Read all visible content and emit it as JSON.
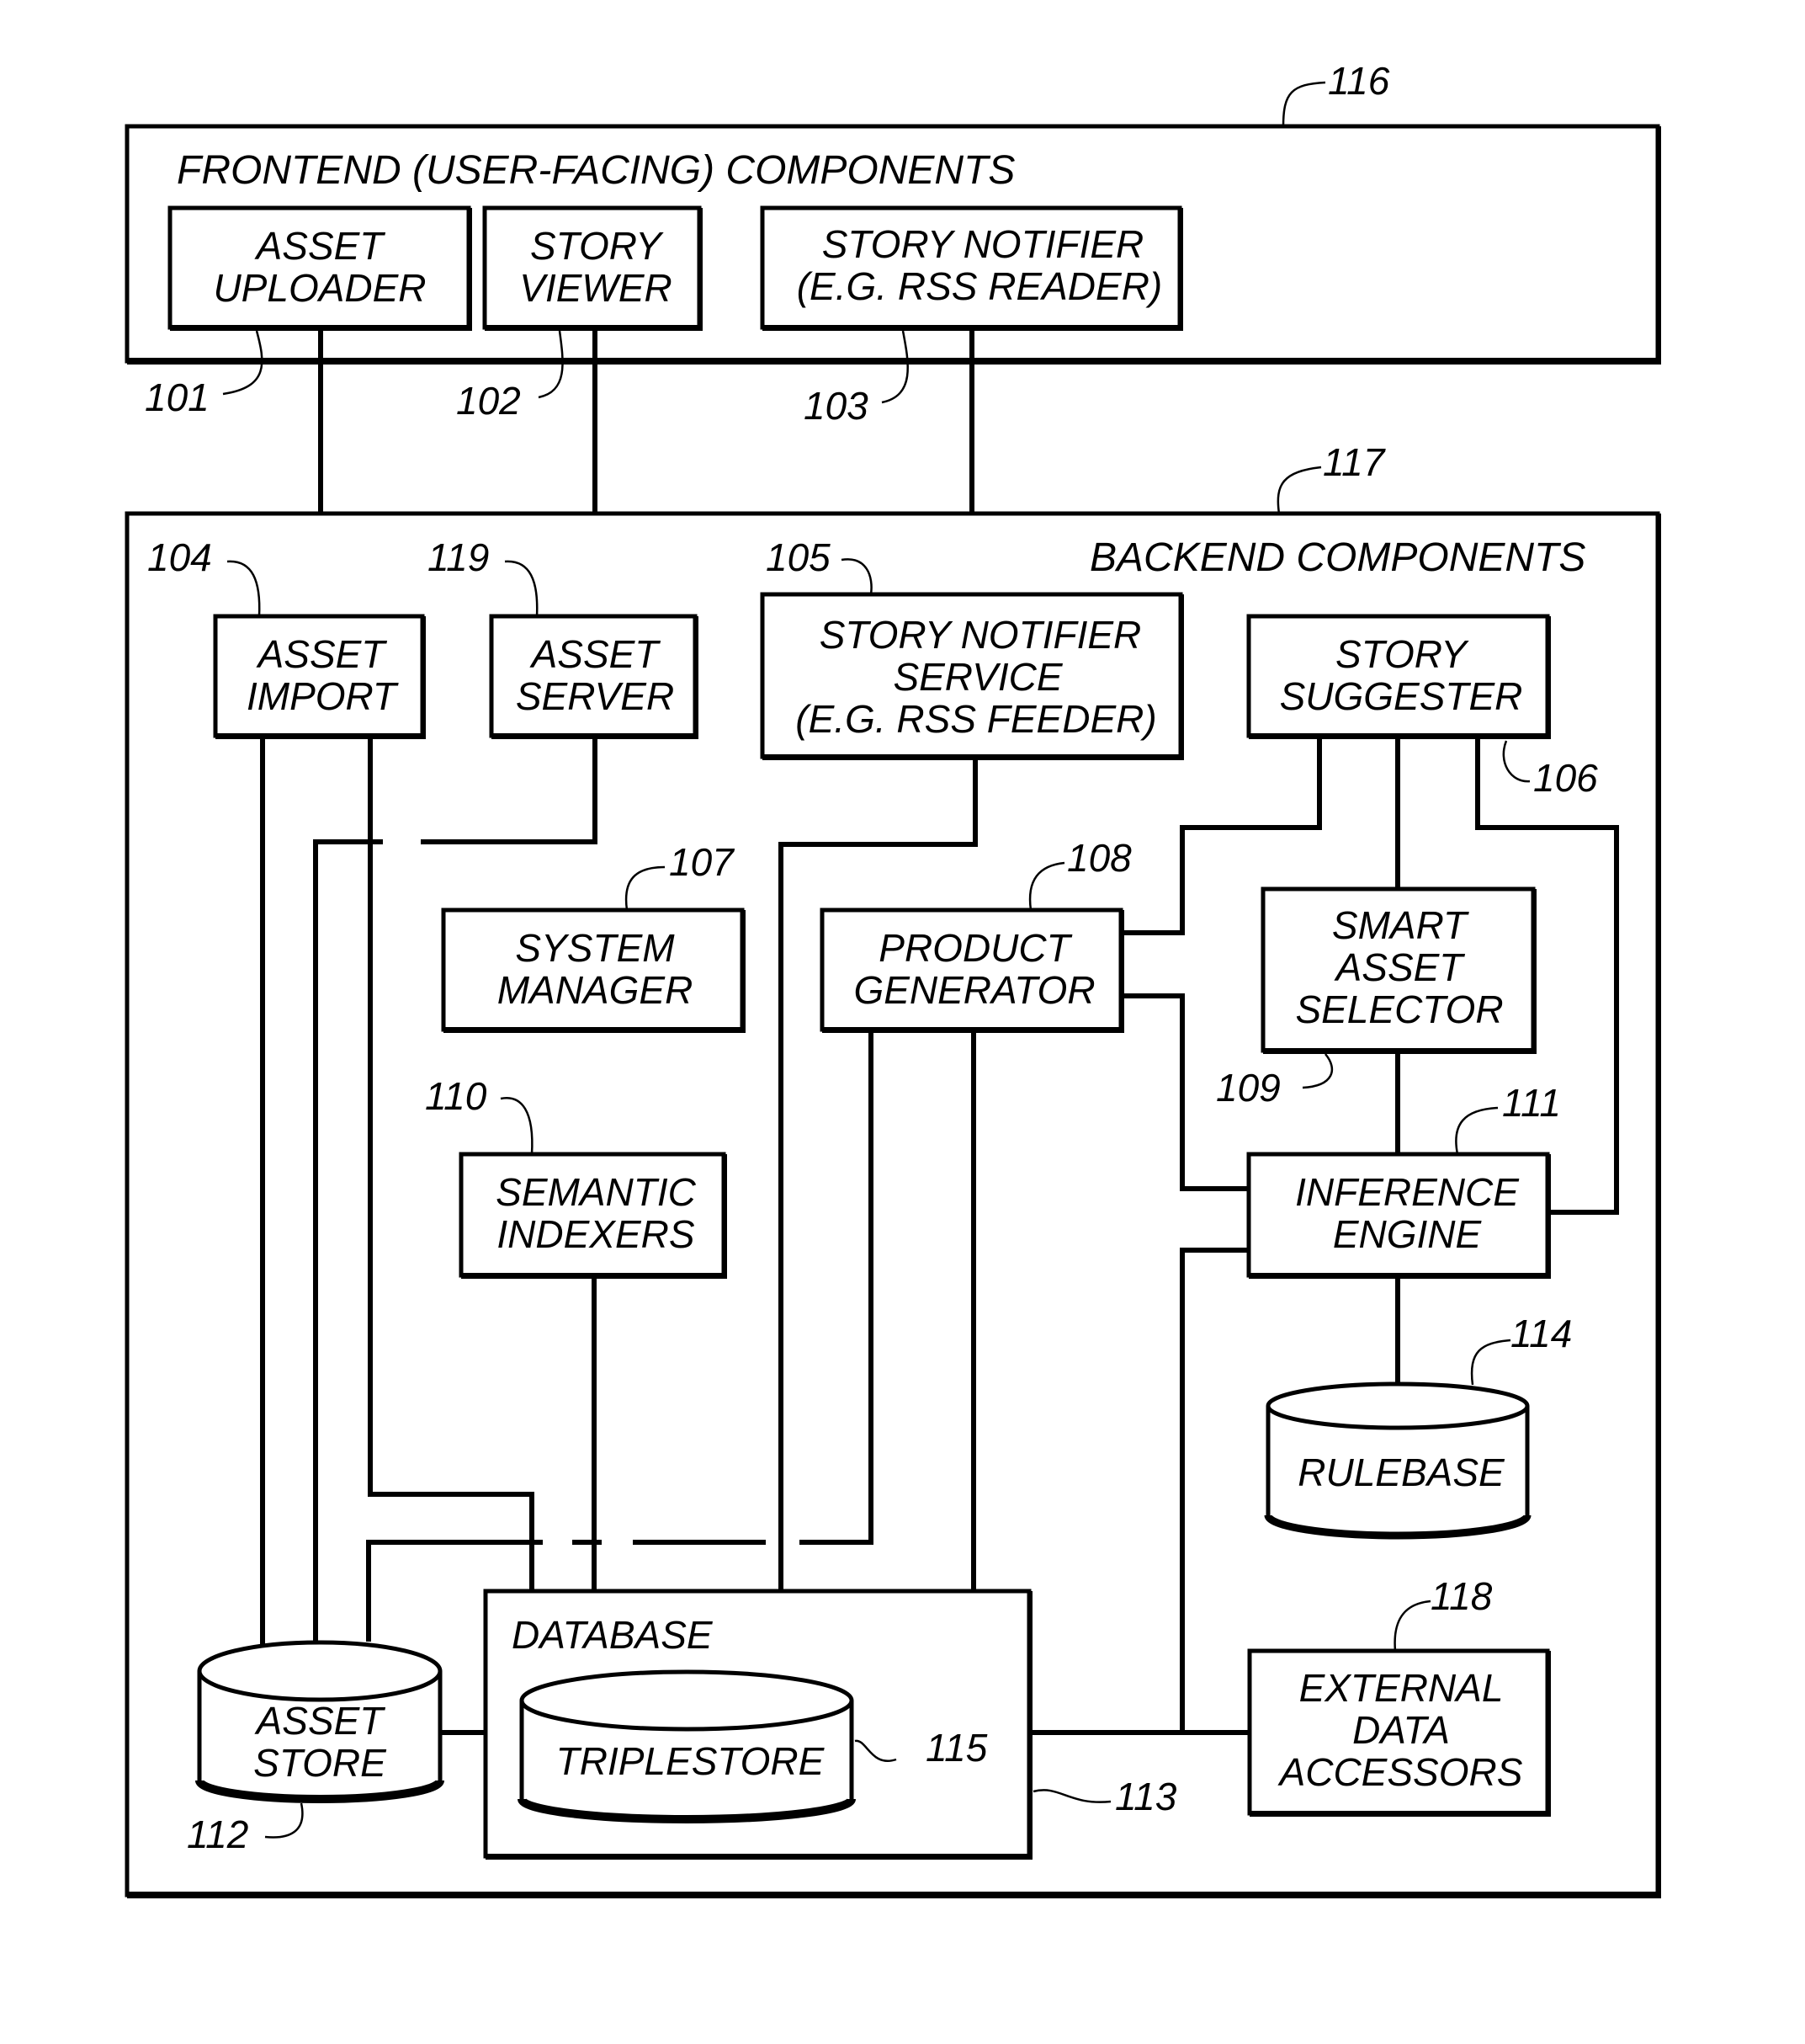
{
  "frontend": {
    "title": "FRONTEND (USER-FACING) COMPONENTS",
    "ref": "116",
    "components": [
      {
        "ref": "101",
        "lines": [
          "ASSET",
          "UPLOADER"
        ]
      },
      {
        "ref": "102",
        "lines": [
          "STORY",
          "VIEWER"
        ]
      },
      {
        "ref": "103",
        "lines": [
          "STORY NOTIFIER",
          "(E.G. RSS READER)"
        ]
      }
    ]
  },
  "backend": {
    "title": "BACKEND COMPONENTS",
    "ref": "117",
    "components": [
      {
        "ref": "104",
        "lines": [
          "ASSET",
          "IMPORT"
        ]
      },
      {
        "ref": "119",
        "lines": [
          "ASSET",
          "SERVER"
        ]
      },
      {
        "ref": "105",
        "lines": [
          "STORY NOTIFIER",
          "SERVICE",
          "(E.G. RSS FEEDER)"
        ]
      },
      {
        "ref": "106",
        "lines": [
          "STORY",
          "SUGGESTER"
        ]
      },
      {
        "ref": "107",
        "lines": [
          "SYSTEM",
          "MANAGER"
        ]
      },
      {
        "ref": "108",
        "lines": [
          "PRODUCT",
          "GENERATOR"
        ]
      },
      {
        "ref": "109",
        "lines": [
          "SMART",
          "ASSET",
          "SELECTOR"
        ]
      },
      {
        "ref": "110",
        "lines": [
          "SEMANTIC",
          "INDEXERS"
        ]
      },
      {
        "ref": "111",
        "lines": [
          "INFERENCE",
          "ENGINE"
        ]
      },
      {
        "ref": "114",
        "lines": [
          "RULEBASE"
        ]
      },
      {
        "ref": "118",
        "lines": [
          "EXTERNAL",
          "DATA",
          "ACCESSORS"
        ]
      },
      {
        "ref": "112",
        "lines": [
          "ASSET",
          "STORE"
        ]
      },
      {
        "ref": "113",
        "lines": [
          "DATABASE"
        ]
      },
      {
        "ref": "115",
        "lines": [
          "TRIPLESTORE"
        ]
      }
    ]
  }
}
